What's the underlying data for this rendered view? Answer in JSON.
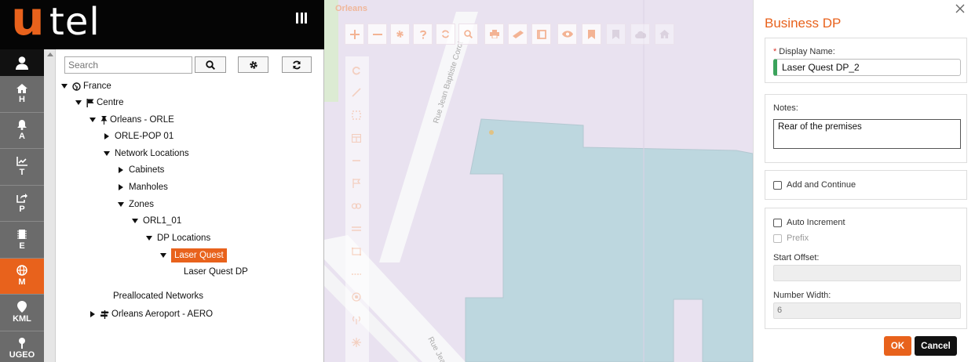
{
  "brand": {
    "logo_accent": "u",
    "logo_rest": "tel",
    "accent_color": "#e8621c"
  },
  "rail": {
    "items": [
      {
        "icon": "home-icon",
        "label": "H"
      },
      {
        "icon": "bell-icon",
        "label": "A"
      },
      {
        "icon": "chart-icon",
        "label": "T"
      },
      {
        "icon": "share-icon",
        "label": "P"
      },
      {
        "icon": "chip-icon",
        "label": "E"
      },
      {
        "icon": "globe-icon",
        "label": "M",
        "active": true
      },
      {
        "icon": "map-pin-icon",
        "label": "KML"
      },
      {
        "icon": "pushpin-icon",
        "label": "UGEO"
      }
    ]
  },
  "tree": {
    "search_placeholder": "Search",
    "nodes": [
      {
        "label": "France",
        "icon": "globe-icon"
      },
      {
        "label": "Centre",
        "icon": "flag-icon"
      },
      {
        "label": "Orleans - ORLE",
        "icon": "pushpin-icon"
      },
      {
        "label": "ORLE-POP 01"
      },
      {
        "label": "Network Locations"
      },
      {
        "label": "Cabinets"
      },
      {
        "label": "Manholes"
      },
      {
        "label": "Zones"
      },
      {
        "label": "ORL1_01"
      },
      {
        "label": "DP Locations"
      },
      {
        "label": "Laser Quest",
        "selected": true
      },
      {
        "label": "Laser Quest DP"
      },
      {
        "label": "Preallocated Networks"
      },
      {
        "label": "Orleans Aeroport - AERO",
        "icon": "signpost-icon"
      }
    ]
  },
  "map": {
    "title": "Orleans",
    "streets": [
      "Rue Jean Baptiste Corot",
      "Rue Jean"
    ],
    "toolbar": [
      "zoom-in",
      "zoom-out",
      "settings",
      "help",
      "refresh",
      "search",
      "print",
      "measure",
      "layers",
      "visibility",
      "bookmark",
      "bookmark-disabled",
      "cloud-disabled",
      "home-disabled"
    ]
  },
  "dialog": {
    "title": "Business DP",
    "display_name_label": "Display Name:",
    "display_name_value": "Laser Quest DP_2",
    "notes_label": "Notes:",
    "notes_value": "Rear of the premises",
    "add_continue_label": "Add and Continue",
    "auto_increment_label": "Auto Increment",
    "prefix_label": "Prefix",
    "start_offset_label": "Start Offset:",
    "start_offset_value": "",
    "number_width_label": "Number Width:",
    "number_width_value": "6",
    "ok_label": "OK",
    "cancel_label": "Cancel"
  }
}
